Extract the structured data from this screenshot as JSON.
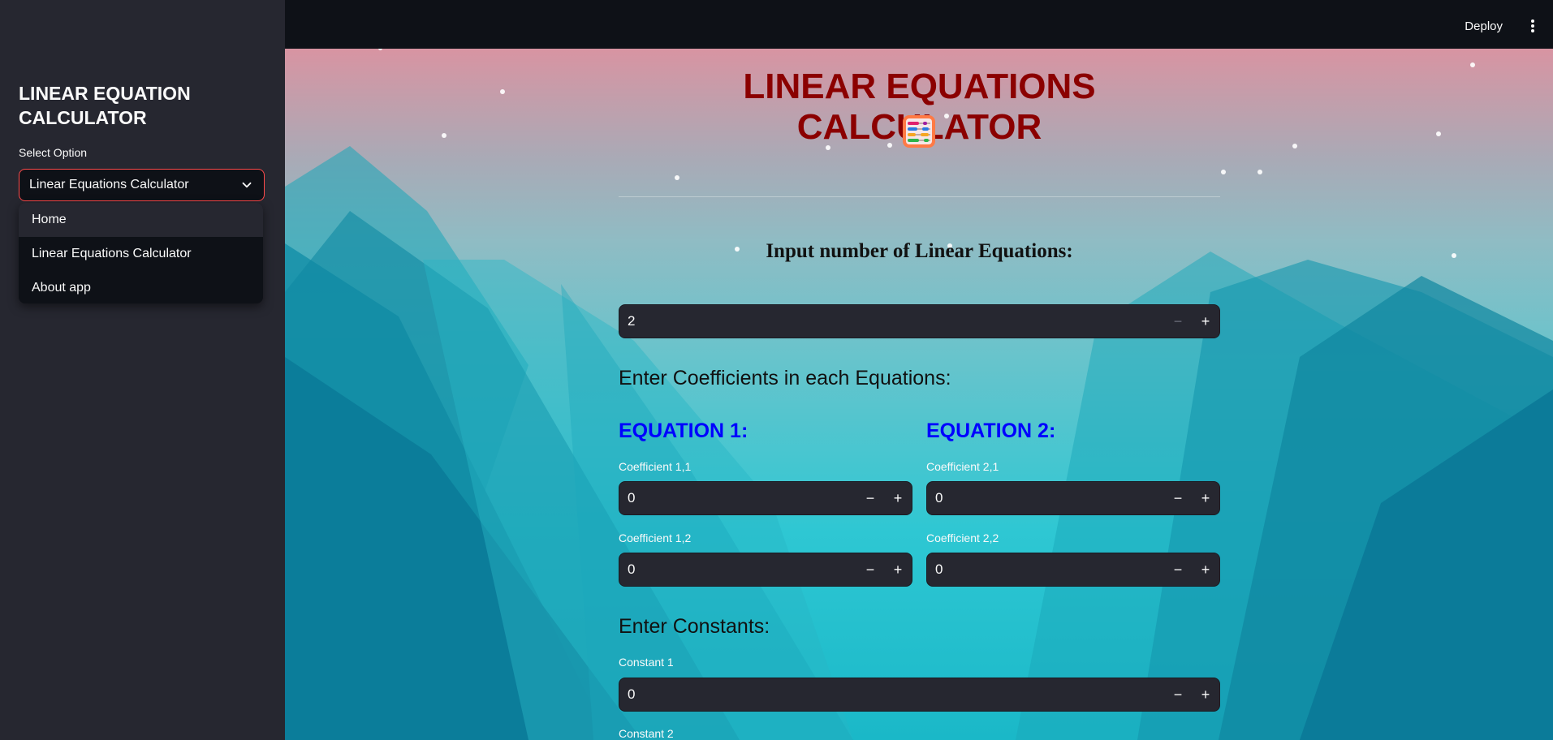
{
  "sidebar": {
    "title": "LINEAR EQUATION CALCULATOR",
    "select_label": "Select Option",
    "select_value": "Linear Equations Calculator",
    "options": [
      "Home",
      "Linear Equations Calculator",
      "About app"
    ]
  },
  "header": {
    "deploy_label": "Deploy"
  },
  "main": {
    "title": "LINEAR EQUATIONS CALCULATOR",
    "subtitle": "Input number of Linear Equations:",
    "num_equations": "2",
    "coeff_heading": "Enter Coefficients in each Equations:",
    "equations": [
      {
        "heading": "EQUATION 1:",
        "fields": [
          {
            "label": "Coefficient 1,1",
            "value": "0"
          },
          {
            "label": "Coefficient 1,2",
            "value": "0"
          }
        ]
      },
      {
        "heading": "EQUATION 2:",
        "fields": [
          {
            "label": "Coefficient 2,1",
            "value": "0"
          },
          {
            "label": "Coefficient 2,2",
            "value": "0"
          }
        ]
      }
    ],
    "constants_heading": "Enter Constants:",
    "constants": [
      {
        "label": "Constant 1",
        "value": "0"
      },
      {
        "label": "Constant 2",
        "value": ""
      }
    ]
  },
  "colors": {
    "accent": "#ff4b4b",
    "title": "#8b0000",
    "equation_heading": "#0000ff",
    "sidebar_bg": "#262730",
    "app_bg": "#0e1117"
  },
  "icons": {
    "select": "chevron-down-icon",
    "menu": "kebab-menu-icon",
    "title_emoji": "abacus-icon"
  }
}
